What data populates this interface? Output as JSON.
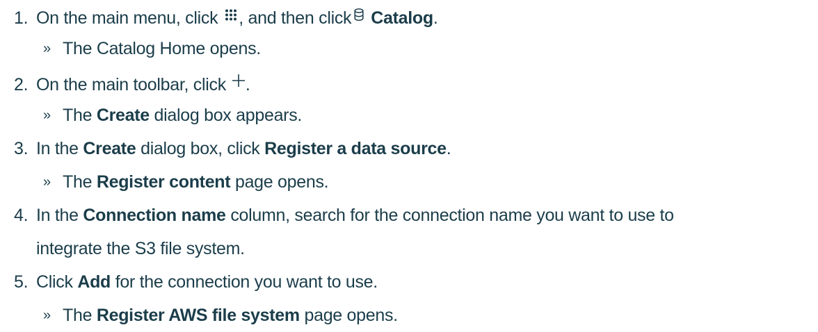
{
  "steps": [
    {
      "num": "1.",
      "before": "On the main menu, click",
      "icon1": "grid-dots-icon",
      "middle": ", and then click",
      "icon2": "database-icon",
      "bold": "Catalog",
      "after": ".",
      "result": {
        "marker": "»",
        "text": "The Catalog Home opens."
      }
    },
    {
      "num": "2.",
      "before": "On the main toolbar, click",
      "icon": "plus-icon",
      "after": ".",
      "result": {
        "marker": "»",
        "before": "The",
        "bold": "Create",
        "after": "dialog box appears."
      }
    },
    {
      "num": "3.",
      "before": "In the",
      "bold1": "Create",
      "middle": "dialog box, click",
      "bold2": "Register a data source",
      "after": ".",
      "result": {
        "marker": "»",
        "before": "The",
        "bold": "Register content",
        "after": "page opens."
      }
    },
    {
      "num": "4.",
      "before": "In the",
      "bold": "Connection name",
      "after": "column, search for the connection name you want to use to",
      "continuation": "integrate the S3 file system."
    },
    {
      "num": "5.",
      "before": "Click",
      "bold": "Add",
      "after": "for the connection you want to use.",
      "result": {
        "marker": "»",
        "before": "The",
        "bold": "Register AWS file system",
        "after": "page opens."
      }
    }
  ],
  "colors": {
    "text": "#1b3d4a"
  }
}
